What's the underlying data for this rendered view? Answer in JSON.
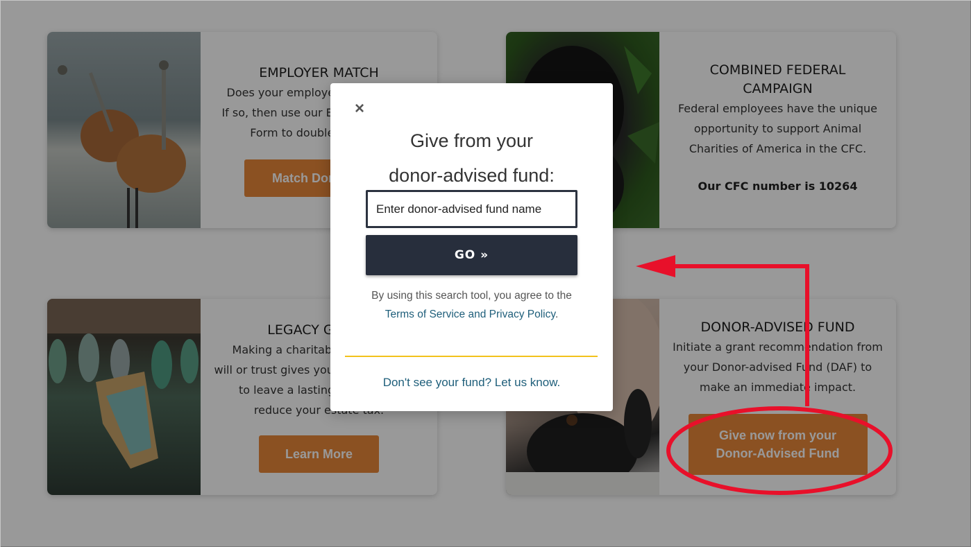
{
  "cards": {
    "employer": {
      "title": "EMPLOYER MATCH",
      "line1": "Does your employer match gifts?",
      "line2": "If so, then use our Employer Match",
      "line3": "Form to double your gift.",
      "button": "Match Donation"
    },
    "cfc": {
      "title_line1": "COMBINED FEDERAL",
      "title_line2": "CAMPAIGN",
      "line1": "Federal employees have the unique",
      "line2": "opportunity to support Animal",
      "line3": "Charities of America in the CFC.",
      "number": "Our CFC number is 10264"
    },
    "legacy": {
      "title": "LEGACY GIVING",
      "line1": "Making a charitable gift in your",
      "line2": "will or trust gives you the opportunity",
      "line3": "to leave a lasting legacy and",
      "line4": "reduce your estate tax.",
      "button": "Learn More"
    },
    "daf": {
      "title": "DONOR-ADVISED FUND",
      "line1": "Initiate a grant recommendation from",
      "line2": "your Donor-advised Fund (DAF) to",
      "line3": "make an immediate impact.",
      "button_line1": "Give now from your",
      "button_line2": "Donor-Advised Fund"
    }
  },
  "modal": {
    "close_icon": "×",
    "title_line1": "Give from your",
    "title_line2": "donor-advised fund:",
    "input_placeholder": "Enter donor-advised fund name",
    "go_button": "GO »",
    "agree_text": "By using this search tool, you agree to the",
    "tos_link": "Terms of Service and Privacy Policy",
    "tos_period": ".",
    "not_found_link": "Don't see your fund? Let us know."
  },
  "colors": {
    "accent_orange": "#e8873a",
    "go_button": "#272e3c",
    "divider_yellow": "#f2c21b",
    "link_blue": "#1e5e7a",
    "annotation_red": "#e8102a"
  },
  "icons": {
    "close": "close-icon",
    "annotation": "red-arrow-annotation"
  }
}
